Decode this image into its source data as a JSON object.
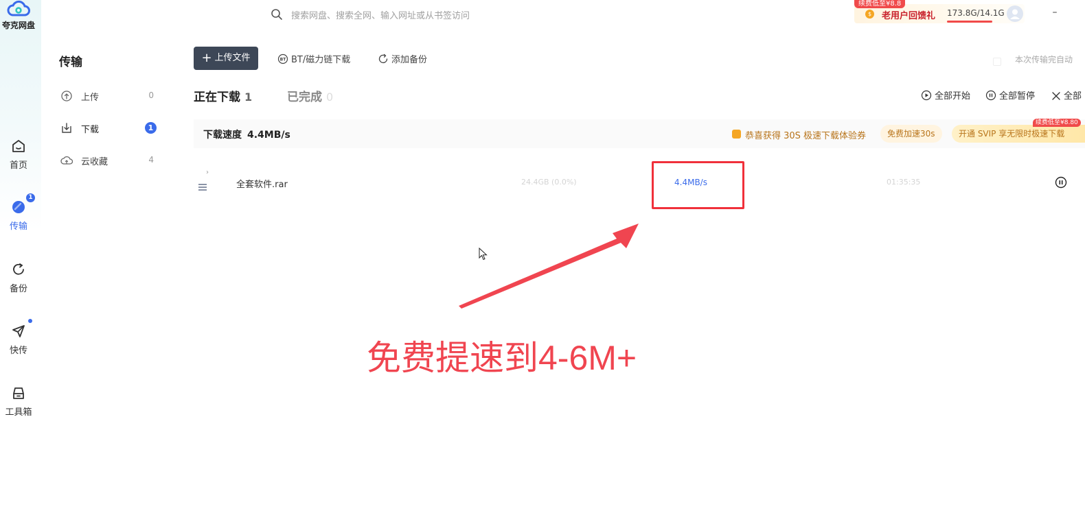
{
  "app": {
    "logo_text": "夸克网盘"
  },
  "rail": {
    "items": [
      {
        "label": "首页",
        "icon": "home-icon"
      },
      {
        "label": "传输",
        "icon": "transfer-icon",
        "badge": "1"
      },
      {
        "label": "备份",
        "icon": "backup-icon"
      },
      {
        "label": "快传",
        "icon": "quick-send-icon"
      },
      {
        "label": "工具箱",
        "icon": "toolbox-icon"
      }
    ]
  },
  "topbar": {
    "search_placeholder": "搜索网盘、搜索全网、输入网址或从书签访问",
    "promo_tag": "续费低至¥8.8",
    "promo_text": "老用户回馈礼",
    "storage_text": "173.8G/14.1G",
    "storage_fill_fraction": 1.0,
    "minimize_label": "–"
  },
  "sidebar": {
    "title": "传输",
    "items": [
      {
        "label": "上传",
        "count": "0",
        "icon": "upload-icon"
      },
      {
        "label": "下载",
        "count": "1",
        "icon": "download-icon"
      },
      {
        "label": "云收藏",
        "count": "4",
        "icon": "cloud-save-icon"
      }
    ]
  },
  "toolbar": {
    "upload_label": "上传文件",
    "bt_label": "BT/磁力链下载",
    "backup_label": "添加备份",
    "auto_shutdown_label": "本次传输完自动"
  },
  "tabs": {
    "downloading_label": "正在下载",
    "downloading_count": "1",
    "completed_label": "已完成",
    "completed_count": "0"
  },
  "actions": {
    "start_all": "全部开始",
    "pause_all": "全部暂停",
    "clear_all": "全部"
  },
  "speed_row": {
    "label": "下载速度",
    "value": "4.4MB/s",
    "coupon_text": "恭喜获得 30S 极速下载体验券",
    "accel_label": "免费加速30s",
    "svip_label": "开通 SVIP 享无限时极速下载",
    "svip_tag": "续费低至¥8.80"
  },
  "file_row": {
    "name": "全套软件.rar",
    "size": "24.4GB (0.0%)",
    "speed": "4.4MB/s",
    "time_left": "01:35:35"
  },
  "annotation": {
    "text": "免费提速到4-6M+"
  },
  "colors": {
    "accent": "#3a6bea",
    "annotation_red": "#f04550",
    "upload_button": "#3d4757"
  }
}
